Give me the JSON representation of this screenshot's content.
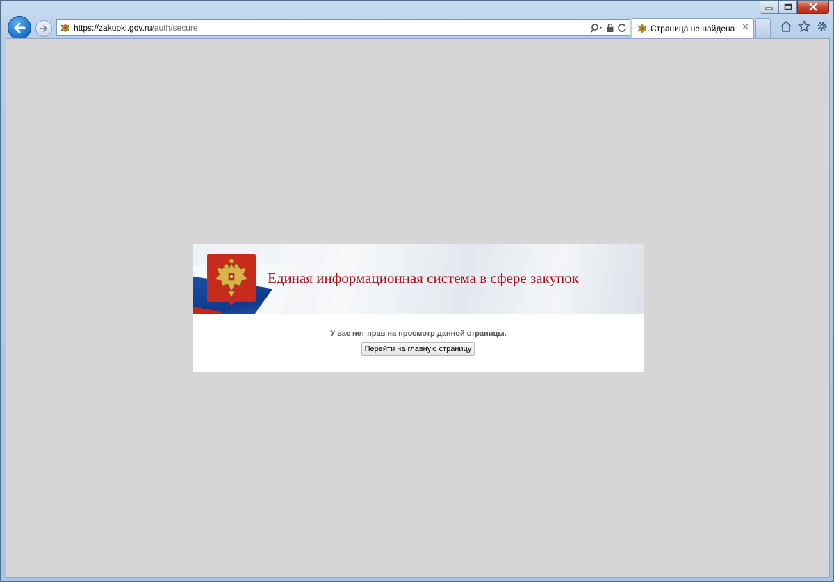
{
  "browser": {
    "address_url_host": "https://zakupki.gov.ru",
    "address_url_path": "/auth/secure",
    "tab_title": "Страница не найдена",
    "tab_close_glyph": "✕"
  },
  "icons": {
    "back": "back-arrow-icon",
    "forward": "forward-arrow-icon",
    "search": "search-icon",
    "lock": "lock-icon",
    "refresh": "refresh-icon",
    "home": "home-icon",
    "favorites": "star-icon",
    "settings": "gear-icon",
    "emblem": "coat-of-arms-icon"
  },
  "page": {
    "site_title": "Единая информационная система в сфере закупок",
    "message": "У вас нет прав на просмотр данной страницы.",
    "home_button_label": "Перейти на главную страницу"
  },
  "colors": {
    "viewport_bg": "#d6d6d6",
    "title_red": "#a7141a",
    "emblem_red": "#c62b1c",
    "flag_blue": "#1d4fa8"
  }
}
